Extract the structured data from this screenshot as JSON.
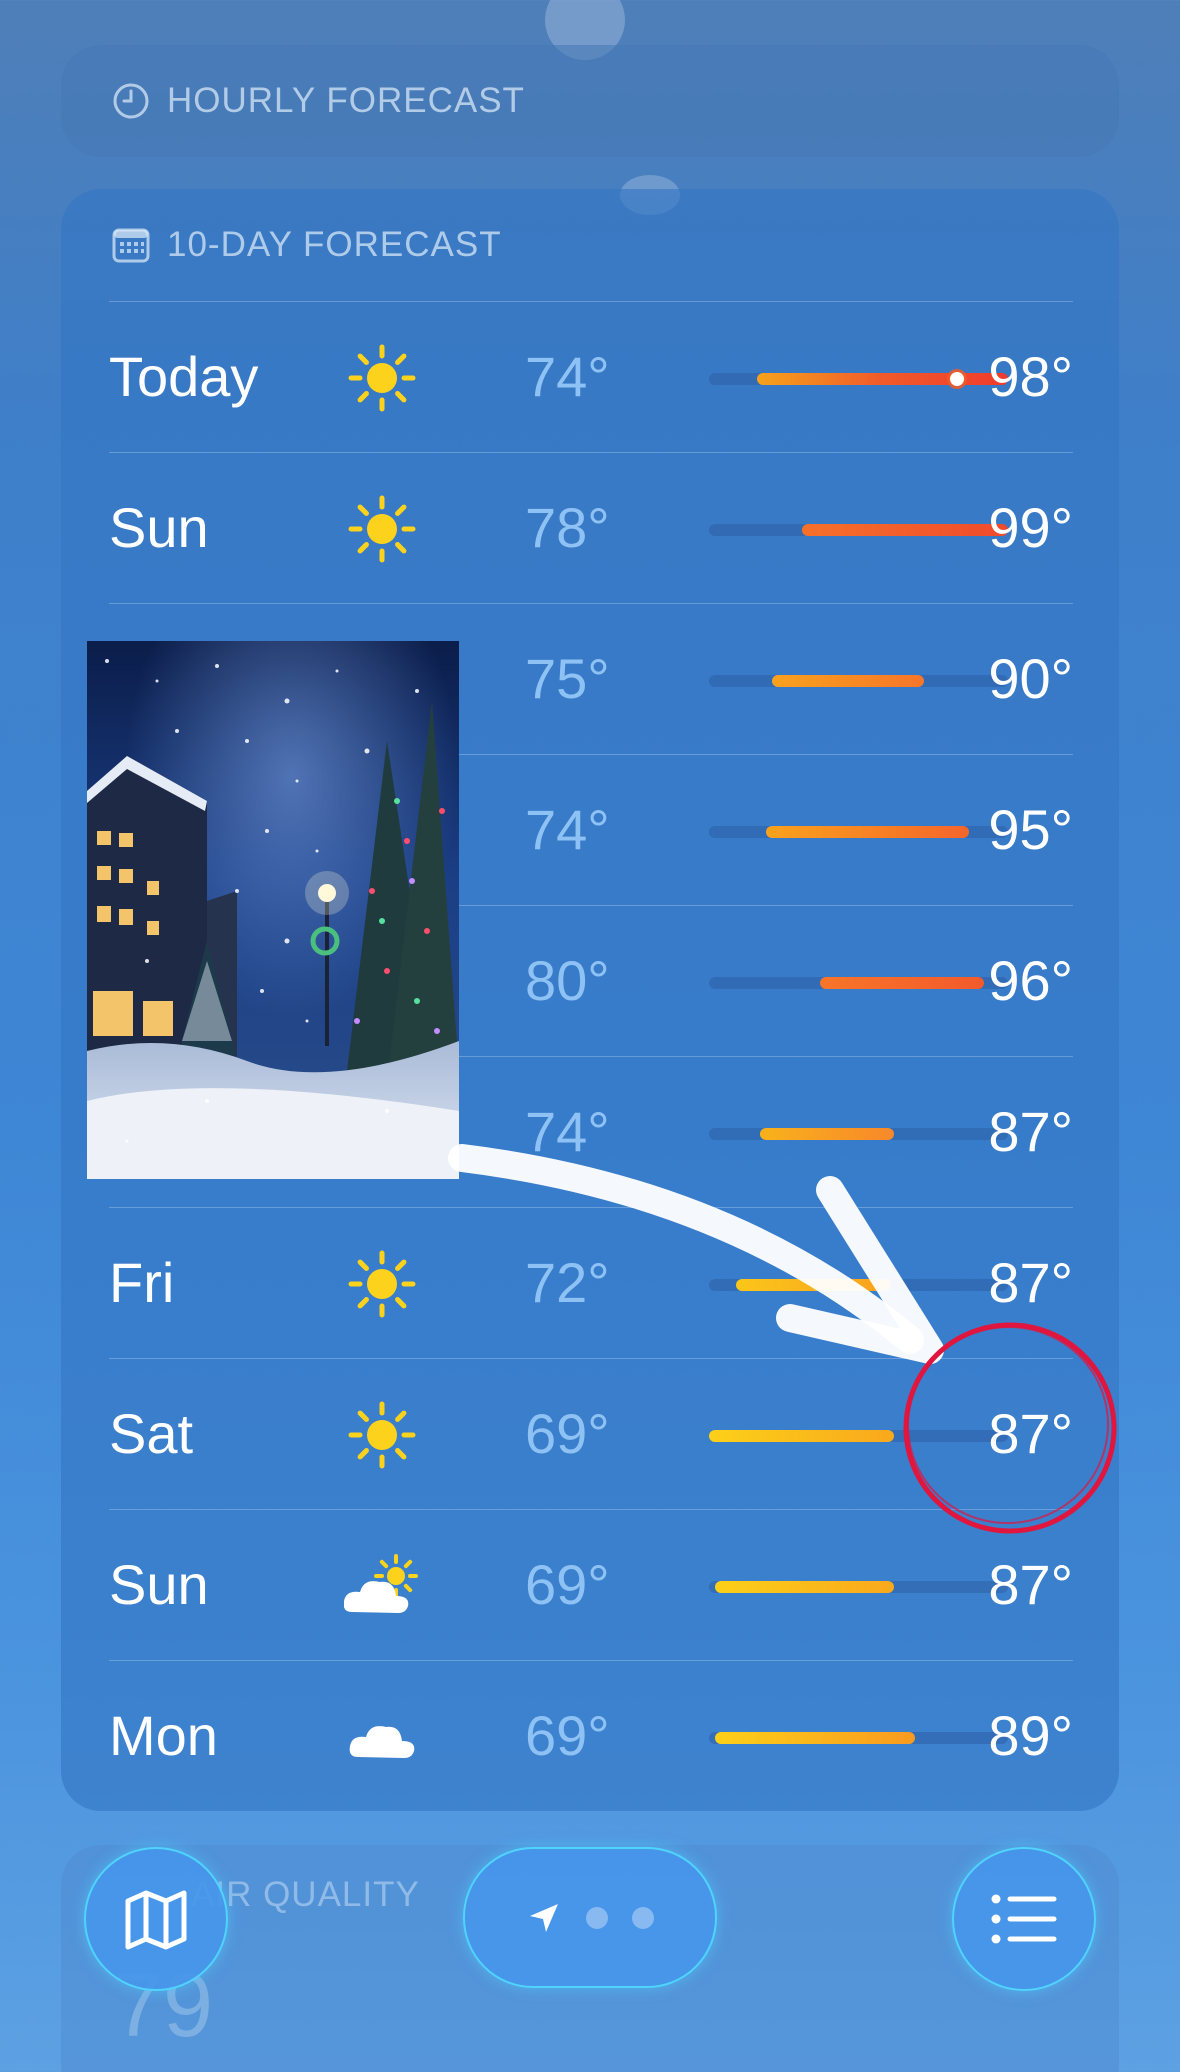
{
  "hourly": {
    "title": "HOURLY FORECAST"
  },
  "ten_day": {
    "title": "10-DAY FORECAST",
    "rows": [
      {
        "day": "Today",
        "icon": "sun-icon",
        "low": "74°",
        "high": "98°",
        "bar_start": 0.16,
        "bar_end": 1.0,
        "current": 0.83,
        "colors": [
          "#f7a21b",
          "#f15a2a",
          "#ef3b2c"
        ]
      },
      {
        "day": "Sun",
        "icon": "sun-icon",
        "low": "78°",
        "high": "99°",
        "bar_start": 0.31,
        "bar_end": 1.0,
        "colors": [
          "#f7712a",
          "#ef4a2c"
        ]
      },
      {
        "day": "",
        "icon": "cloud-sun-icon",
        "low": "75°",
        "high": "90°",
        "bar_start": 0.21,
        "bar_end": 0.72,
        "colors": [
          "#f9a21d",
          "#f7752a"
        ]
      },
      {
        "day": "",
        "icon": "sun-icon",
        "low": "74°",
        "high": "95°",
        "bar_start": 0.19,
        "bar_end": 0.87,
        "colors": [
          "#f9a21d",
          "#f5652b"
        ]
      },
      {
        "day": "",
        "icon": "sun-icon",
        "low": "80°",
        "high": "96°",
        "bar_start": 0.37,
        "bar_end": 0.92,
        "colors": [
          "#f7752a",
          "#f35a2b"
        ]
      },
      {
        "day": "",
        "icon": "sun-icon",
        "low": "74°",
        "high": "87°",
        "bar_start": 0.17,
        "bar_end": 0.62,
        "colors": [
          "#f9b21b",
          "#f7882a"
        ]
      },
      {
        "day": "Fri",
        "icon": "sun-icon",
        "low": "72°",
        "high": "87°",
        "bar_start": 0.09,
        "bar_end": 0.61,
        "colors": [
          "#fbc61a",
          "#f9a01d"
        ]
      },
      {
        "day": "Sat",
        "icon": "sun-icon",
        "low": "69°",
        "high": "87°",
        "bar_start": 0.0,
        "bar_end": 0.62,
        "colors": [
          "#fcd019",
          "#f9a81c"
        ]
      },
      {
        "day": "Sun",
        "icon": "cloud-sun-icon",
        "low": "69°",
        "high": "87°",
        "bar_start": 0.02,
        "bar_end": 0.62,
        "colors": [
          "#fcd019",
          "#f9a81c"
        ]
      },
      {
        "day": "Mon",
        "icon": "cloud-icon",
        "low": "69°",
        "high": "89°",
        "bar_start": 0.02,
        "bar_end": 0.69,
        "colors": [
          "#fcd019",
          "#f99a1e"
        ]
      }
    ]
  },
  "air_quality": {
    "title": "AIR QUALITY",
    "value": "79"
  },
  "bottom_bar": {
    "map_icon": "map-icon",
    "location_icon": "location-arrow-icon",
    "list_icon": "list-icon",
    "page_count": 3
  }
}
